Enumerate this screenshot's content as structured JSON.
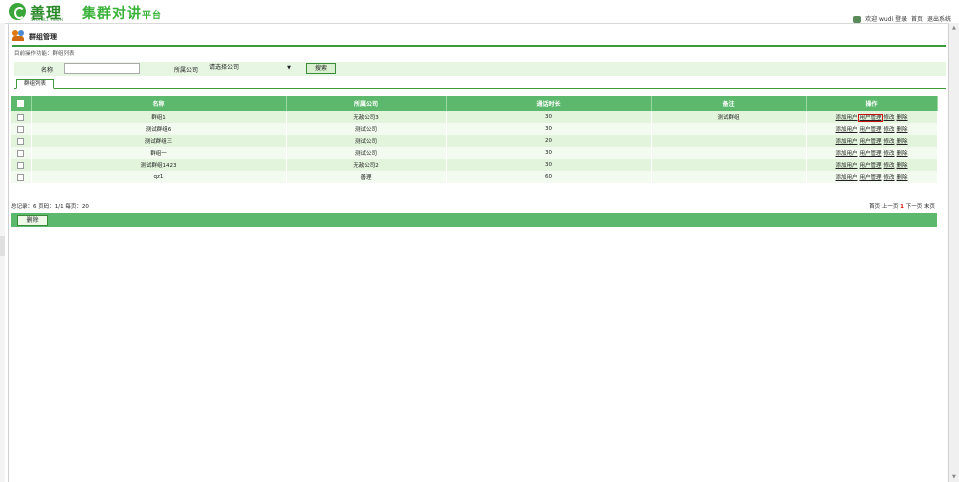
{
  "brand": {
    "name": "善理",
    "sub": "SHANLI TECH",
    "platform_main": "集群对讲",
    "platform_small": "平台"
  },
  "userbar": {
    "welcome": "欢迎 wudi 登录",
    "home": "首页",
    "logout": "退出系统"
  },
  "page": {
    "title": "群组管理",
    "breadcrumb": "目前操作功能：群组列表"
  },
  "search": {
    "name_label": "名称",
    "name_value": "",
    "company_label": "所属公司",
    "company_select": "请选择公司",
    "search_button": "搜索"
  },
  "tabs": [
    {
      "label": "群组列表"
    }
  ],
  "table": {
    "headers": [
      "名称",
      "所属公司",
      "通话时长",
      "备注",
      "操作"
    ],
    "rows": [
      {
        "name": "群组1",
        "company": "无敌公司3",
        "duration": "30",
        "note": "测试群组"
      },
      {
        "name": "测试群组6",
        "company": "测试公司",
        "duration": "30",
        "note": ""
      },
      {
        "name": "测试群组三",
        "company": "测试公司",
        "duration": "20",
        "note": ""
      },
      {
        "name": "群组一",
        "company": "测试公司",
        "duration": "30",
        "note": ""
      },
      {
        "name": "测试群组1423",
        "company": "无敌公司2",
        "duration": "30",
        "note": ""
      },
      {
        "name": "qz1",
        "company": "善理",
        "duration": "60",
        "note": ""
      }
    ],
    "actions": {
      "add_user": "添加用户",
      "user_manage": "用户管理",
      "edit": "修改",
      "delete": "删除"
    }
  },
  "pagination": {
    "summary": "总记录：6 页码：1/1 每页：20",
    "first": "首页",
    "prev": "上一页",
    "current": "1",
    "next": "下一页",
    "last": "末页"
  },
  "bulk": {
    "delete_button": "删除"
  },
  "colors": {
    "accent": "#5cb86c",
    "row_light": "#f3fbf0",
    "row_dark": "#e2f5dc",
    "highlight_box": "#d01010"
  }
}
